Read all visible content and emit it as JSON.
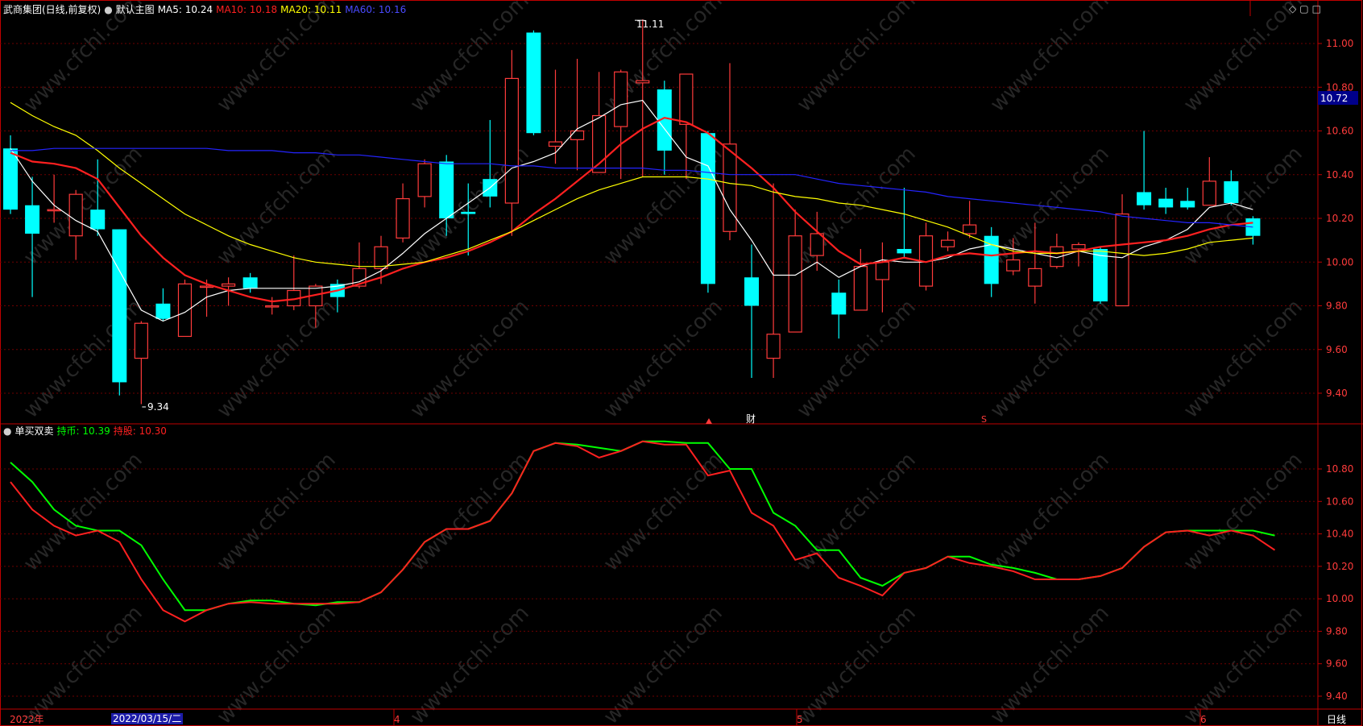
{
  "header": {
    "stock_name": "武商集团(日线,前复权)",
    "main_chart_label": "默认主图",
    "ma5": "MA5: 10.24",
    "ma10": "MA10: 10.18",
    "ma20": "MA20: 10.11",
    "ma60": "MA60: 10.16",
    "icons": [
      "settings-dot-icon",
      "diamond-icon",
      "window-restore-icon",
      "window-max-icon"
    ]
  },
  "indicator_header": {
    "name": "单买双卖",
    "hold_coin": "持币: 10.39",
    "hold_stock": "持股: 10.30"
  },
  "bottom_bar": {
    "year_label": "2022年",
    "cursor_date": "2022/03/15/二",
    "month_labels": [
      "4",
      "5",
      "6"
    ],
    "period_button": "日线"
  },
  "annotations": {
    "high": "11.11",
    "low": "9.34",
    "current_price": "10.72",
    "finance_marker": "财",
    "event_marker": "S"
  },
  "colors": {
    "up": "#ff3b3b",
    "down": "#00ffff",
    "ma5": "#ffffff",
    "ma10": "#ff2020",
    "ma20": "#ffff00",
    "ma60": "#2424ff",
    "hold_coin_line": "#00ff00",
    "hold_stock_line": "#ff2020",
    "axis": "#c00000",
    "watermark": "#262626"
  },
  "watermark_text": "www.cfchi.com",
  "chart_data": [
    {
      "type": "candlestick",
      "title": "武商集团(日线,前复权)",
      "yticks": [
        "9.40",
        "9.60",
        "9.80",
        "10.00",
        "10.20",
        "10.40",
        "10.60",
        "10.80",
        "11.00"
      ],
      "ylim": [
        9.3,
        11.15
      ],
      "candles": [
        {
          "o": 10.52,
          "h": 10.58,
          "l": 10.22,
          "c": 10.24
        },
        {
          "o": 10.26,
          "h": 10.39,
          "l": 9.84,
          "c": 10.13
        },
        {
          "o": 10.24,
          "h": 10.4,
          "l": 10.18,
          "c": 10.24
        },
        {
          "o": 10.12,
          "h": 10.33,
          "l": 10.01,
          "c": 10.31
        },
        {
          "o": 10.24,
          "h": 10.47,
          "l": 10.12,
          "c": 10.15
        },
        {
          "o": 10.15,
          "h": 10.15,
          "l": 9.39,
          "c": 9.45
        },
        {
          "o": 9.56,
          "h": 9.73,
          "l": 9.35,
          "c": 9.72
        },
        {
          "o": 9.81,
          "h": 9.88,
          "l": 9.73,
          "c": 9.74
        },
        {
          "o": 9.66,
          "h": 9.92,
          "l": 9.66,
          "c": 9.9
        },
        {
          "o": 9.89,
          "h": 9.92,
          "l": 9.75,
          "c": 9.89
        },
        {
          "o": 9.89,
          "h": 9.93,
          "l": 9.8,
          "c": 9.9
        },
        {
          "o": 9.93,
          "h": 9.95,
          "l": 9.86,
          "c": 9.88
        },
        {
          "o": 9.8,
          "h": 9.84,
          "l": 9.76,
          "c": 9.8
        },
        {
          "o": 9.8,
          "h": 10.03,
          "l": 9.78,
          "c": 9.87
        },
        {
          "o": 9.8,
          "h": 9.9,
          "l": 9.7,
          "c": 9.89
        },
        {
          "o": 9.9,
          "h": 9.92,
          "l": 9.77,
          "c": 9.84
        },
        {
          "o": 9.89,
          "h": 10.09,
          "l": 9.88,
          "c": 9.97
        },
        {
          "o": 9.97,
          "h": 10.12,
          "l": 9.9,
          "c": 10.07
        },
        {
          "o": 10.11,
          "h": 10.36,
          "l": 10.09,
          "c": 10.29
        },
        {
          "o": 10.3,
          "h": 10.47,
          "l": 10.25,
          "c": 10.45
        },
        {
          "o": 10.46,
          "h": 10.49,
          "l": 10.12,
          "c": 10.2
        },
        {
          "o": 10.23,
          "h": 10.36,
          "l": 10.03,
          "c": 10.22
        },
        {
          "o": 10.38,
          "h": 10.65,
          "l": 10.25,
          "c": 10.3
        },
        {
          "o": 10.27,
          "h": 10.97,
          "l": 10.12,
          "c": 10.84
        },
        {
          "o": 11.05,
          "h": 11.06,
          "l": 10.58,
          "c": 10.59
        },
        {
          "o": 10.53,
          "h": 10.88,
          "l": 10.45,
          "c": 10.55
        },
        {
          "o": 10.56,
          "h": 10.93,
          "l": 10.42,
          "c": 10.6
        },
        {
          "o": 10.41,
          "h": 10.87,
          "l": 10.41,
          "c": 10.67
        },
        {
          "o": 10.62,
          "h": 10.88,
          "l": 10.38,
          "c": 10.87
        },
        {
          "o": 10.82,
          "h": 11.11,
          "l": 10.39,
          "c": 10.83
        },
        {
          "o": 10.79,
          "h": 10.83,
          "l": 10.4,
          "c": 10.51
        },
        {
          "o": 10.63,
          "h": 10.86,
          "l": 10.38,
          "c": 10.86
        },
        {
          "o": 10.59,
          "h": 10.6,
          "l": 9.86,
          "c": 9.9
        },
        {
          "o": 10.14,
          "h": 10.91,
          "l": 10.1,
          "c": 10.54
        },
        {
          "o": 9.93,
          "h": 10.08,
          "l": 9.47,
          "c": 9.8
        },
        {
          "o": 9.56,
          "h": 10.36,
          "l": 9.47,
          "c": 9.67
        },
        {
          "o": 9.68,
          "h": 10.24,
          "l": 9.68,
          "c": 10.12
        },
        {
          "o": 10.03,
          "h": 10.23,
          "l": 9.96,
          "c": 10.13
        },
        {
          "o": 9.86,
          "h": 9.92,
          "l": 9.65,
          "c": 9.76
        },
        {
          "o": 9.78,
          "h": 10.06,
          "l": 9.78,
          "c": 9.98
        },
        {
          "o": 9.92,
          "h": 10.09,
          "l": 9.77,
          "c": 10.0
        },
        {
          "o": 10.06,
          "h": 10.34,
          "l": 10.02,
          "c": 10.04
        },
        {
          "o": 9.89,
          "h": 10.18,
          "l": 9.87,
          "c": 10.12
        },
        {
          "o": 10.07,
          "h": 10.14,
          "l": 10.05,
          "c": 10.1
        },
        {
          "o": 10.13,
          "h": 10.28,
          "l": 10.11,
          "c": 10.17
        },
        {
          "o": 10.12,
          "h": 10.16,
          "l": 9.84,
          "c": 9.9
        },
        {
          "o": 9.96,
          "h": 10.11,
          "l": 9.94,
          "c": 10.01
        },
        {
          "o": 9.89,
          "h": 10.18,
          "l": 9.81,
          "c": 9.97
        },
        {
          "o": 9.98,
          "h": 10.13,
          "l": 9.97,
          "c": 10.07
        },
        {
          "o": 10.06,
          "h": 10.09,
          "l": 9.98,
          "c": 10.08
        },
        {
          "o": 10.06,
          "h": 10.07,
          "l": 9.81,
          "c": 9.82
        },
        {
          "o": 9.8,
          "h": 10.31,
          "l": 9.8,
          "c": 10.22
        },
        {
          "o": 10.32,
          "h": 10.6,
          "l": 10.24,
          "c": 10.26
        },
        {
          "o": 10.29,
          "h": 10.34,
          "l": 10.22,
          "c": 10.25
        },
        {
          "o": 10.28,
          "h": 10.34,
          "l": 10.24,
          "c": 10.25
        },
        {
          "o": 10.26,
          "h": 10.48,
          "l": 10.26,
          "c": 10.37
        },
        {
          "o": 10.37,
          "h": 10.42,
          "l": 10.26,
          "c": 10.27
        },
        {
          "o": 10.2,
          "h": 10.21,
          "l": 10.08,
          "c": 10.12
        }
      ],
      "series": [
        {
          "name": "MA5",
          "color": "#ffffff",
          "values": [
            10.52,
            10.37,
            10.26,
            10.19,
            10.14,
            9.96,
            9.78,
            9.73,
            9.77,
            9.84,
            9.87,
            9.88,
            9.88,
            9.88,
            9.88,
            9.89,
            9.91,
            9.96,
            10.04,
            10.13,
            10.2,
            10.27,
            10.34,
            10.43,
            10.46,
            10.5,
            10.61,
            10.66,
            10.72,
            10.74,
            10.61,
            10.48,
            10.44,
            10.24,
            10.1,
            9.94,
            9.94,
            10.0,
            9.93,
            9.98,
            10.01,
            10.0,
            10.0,
            10.02,
            10.06,
            10.08,
            10.06,
            10.04,
            10.02,
            10.05,
            10.03,
            10.02,
            10.07,
            10.1,
            10.15,
            10.25,
            10.27,
            10.24
          ]
        },
        {
          "name": "MA10",
          "color": "#ff2020",
          "values": [
            10.5,
            10.46,
            10.45,
            10.43,
            10.38,
            10.25,
            10.12,
            10.02,
            9.94,
            9.9,
            9.87,
            9.84,
            9.82,
            9.83,
            9.85,
            9.87,
            9.9,
            9.93,
            9.97,
            10.0,
            10.02,
            10.05,
            10.09,
            10.14,
            10.22,
            10.29,
            10.37,
            10.45,
            10.54,
            10.61,
            10.66,
            10.64,
            10.59,
            10.51,
            10.43,
            10.34,
            10.23,
            10.14,
            10.05,
            9.99,
            10.0,
            10.02,
            10.0,
            10.03,
            10.04,
            10.03,
            10.04,
            10.05,
            10.04,
            10.05,
            10.07,
            10.08,
            10.09,
            10.1,
            10.12,
            10.15,
            10.17,
            10.18
          ]
        },
        {
          "name": "MA20",
          "color": "#ffff00",
          "values": [
            10.73,
            10.67,
            10.62,
            10.58,
            10.51,
            10.43,
            10.36,
            10.29,
            10.22,
            10.17,
            10.12,
            10.08,
            10.05,
            10.02,
            10.0,
            9.99,
            9.98,
            9.98,
            9.99,
            10.0,
            10.03,
            10.06,
            10.1,
            10.14,
            10.19,
            10.24,
            10.29,
            10.33,
            10.36,
            10.39,
            10.39,
            10.39,
            10.38,
            10.36,
            10.35,
            10.32,
            10.3,
            10.29,
            10.27,
            10.26,
            10.24,
            10.22,
            10.19,
            10.16,
            10.12,
            10.08,
            10.05,
            10.04,
            10.04,
            10.05,
            10.05,
            10.04,
            10.03,
            10.04,
            10.06,
            10.09,
            10.1,
            10.11
          ]
        },
        {
          "name": "MA60",
          "color": "#2424ff",
          "values": [
            10.51,
            10.51,
            10.52,
            10.52,
            10.52,
            10.52,
            10.52,
            10.52,
            10.52,
            10.52,
            10.51,
            10.51,
            10.51,
            10.5,
            10.5,
            10.49,
            10.49,
            10.48,
            10.47,
            10.46,
            10.45,
            10.45,
            10.45,
            10.44,
            10.44,
            10.43,
            10.43,
            10.43,
            10.43,
            10.43,
            10.42,
            10.42,
            10.41,
            10.4,
            10.4,
            10.4,
            10.4,
            10.38,
            10.36,
            10.35,
            10.34,
            10.33,
            10.32,
            10.3,
            10.29,
            10.28,
            10.27,
            10.26,
            10.25,
            10.24,
            10.23,
            10.21,
            10.2,
            10.19,
            10.18,
            10.18,
            10.17,
            10.16
          ]
        }
      ]
    },
    {
      "type": "line",
      "title": "单买双卖",
      "yticks": [
        "9.40",
        "9.60",
        "9.80",
        "10.00",
        "10.20",
        "10.40",
        "10.60",
        "10.80"
      ],
      "ylim": [
        9.34,
        11.0
      ],
      "series": [
        {
          "name": "持币",
          "color": "#00ff00",
          "values": [
            10.84,
            10.72,
            10.55,
            10.45,
            10.42,
            10.42,
            10.33,
            10.12,
            9.93,
            9.93,
            9.97,
            9.99,
            9.99,
            9.97,
            9.96,
            9.98,
            9.98,
            10.04,
            10.18,
            10.35,
            10.43,
            10.43,
            10.48,
            10.65,
            10.91,
            10.96,
            10.95,
            10.93,
            10.91,
            10.97,
            10.97,
            10.96,
            10.96,
            10.8,
            10.8,
            10.53,
            10.45,
            10.3,
            10.3,
            10.13,
            10.08,
            10.16,
            10.19,
            10.26,
            10.26,
            10.21,
            10.19,
            10.16,
            10.12,
            10.12,
            10.14,
            10.19,
            10.32,
            10.41,
            10.42,
            10.42,
            10.42,
            10.42,
            10.39
          ]
        },
        {
          "name": "持股",
          "color": "#ff2020",
          "values": [
            10.72,
            10.55,
            10.45,
            10.39,
            10.42,
            10.35,
            10.12,
            9.93,
            9.86,
            9.93,
            9.97,
            9.98,
            9.97,
            9.97,
            9.97,
            9.97,
            9.98,
            10.04,
            10.18,
            10.35,
            10.43,
            10.43,
            10.48,
            10.65,
            10.91,
            10.96,
            10.94,
            10.87,
            10.91,
            10.97,
            10.95,
            10.95,
            10.76,
            10.79,
            10.53,
            10.45,
            10.24,
            10.28,
            10.13,
            10.08,
            10.02,
            10.16,
            10.19,
            10.26,
            10.22,
            10.2,
            10.17,
            10.12,
            10.12,
            10.12,
            10.14,
            10.19,
            10.32,
            10.41,
            10.42,
            10.39,
            10.42,
            10.39,
            10.3
          ]
        }
      ]
    }
  ]
}
